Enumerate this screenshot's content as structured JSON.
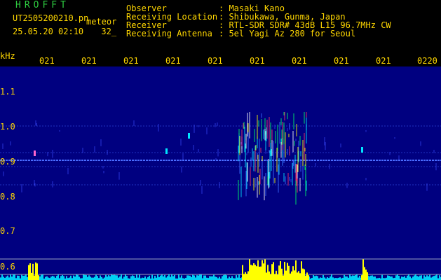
{
  "header": {
    "brand": "HROFFT",
    "file_name": "UT2505200210.pn",
    "file_tag": "meteor",
    "datetime": "25.05.20 02:10",
    "extra": "32_",
    "rows": [
      {
        "label": "Observer",
        "value": ": Masaki Kano"
      },
      {
        "label": "Receiving Location",
        "value": ": Shibukawa, Gunma, Japan"
      },
      {
        "label": "Receiver",
        "value": ": RTL-SDR SDR# 43dB L15 96.7MHz CW"
      },
      {
        "label": "Receiving Antenna",
        "value": ": 5el Yagi Az 280 for Seoul"
      }
    ]
  },
  "axis": {
    "y_unit": "kHz",
    "x_ticks": [
      "021",
      "021",
      "021",
      "021",
      "021",
      "021",
      "021",
      "021",
      "021",
      "0220"
    ],
    "y_ticks": [
      "1.1",
      "1.0",
      "0.9",
      "0.8",
      "0.7",
      "0.6"
    ]
  },
  "colors": {
    "text": "#ffd700",
    "brand": "#2ecc40",
    "background": "#000080",
    "carrier": "#4a6cff",
    "burst": "#ffff00",
    "noise": "#00e5ff"
  }
}
